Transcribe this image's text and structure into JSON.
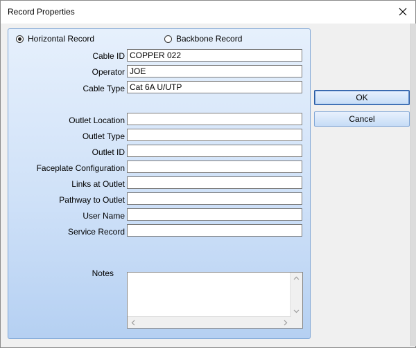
{
  "window": {
    "title": "Record Properties"
  },
  "record_type": {
    "options": [
      {
        "label": "Horizontal Record",
        "checked": true
      },
      {
        "label": "Backbone Record",
        "checked": false
      }
    ]
  },
  "fields": {
    "cable_id": {
      "label": "Cable ID",
      "value": "COPPER 022"
    },
    "operator": {
      "label": "Operator",
      "value": "JOE"
    },
    "cable_type": {
      "label": "Cable Type",
      "value": "Cat 6A U/UTP"
    },
    "outlet_location": {
      "label": "Outlet Location",
      "value": ""
    },
    "outlet_type": {
      "label": "Outlet Type",
      "value": ""
    },
    "outlet_id": {
      "label": "Outlet ID",
      "value": ""
    },
    "faceplate_configuration": {
      "label": "Faceplate Configuration",
      "value": ""
    },
    "links_at_outlet": {
      "label": "Links at Outlet",
      "value": ""
    },
    "pathway_to_outlet": {
      "label": "Pathway to Outlet",
      "value": ""
    },
    "user_name": {
      "label": "User Name",
      "value": ""
    },
    "service_record": {
      "label": "Service Record",
      "value": ""
    },
    "notes": {
      "label": "Notes",
      "value": ""
    }
  },
  "buttons": {
    "ok": "OK",
    "cancel": "Cancel"
  },
  "icons": {
    "close": "close-icon",
    "scroll_up": "chevron-up-icon",
    "scroll_down": "chevron-down-icon",
    "scroll_left": "chevron-left-icon",
    "scroll_right": "chevron-right-icon"
  },
  "colors": {
    "panel_top": "#e6f0fc",
    "panel_bottom": "#b5d0f2",
    "panel_border": "#7fa6d6",
    "button_default_border": "#2b5aa0"
  }
}
